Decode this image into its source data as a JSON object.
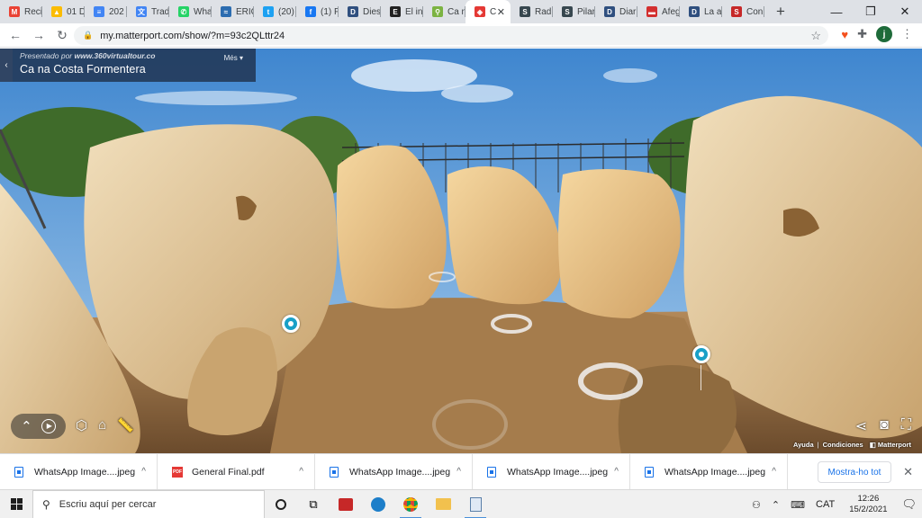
{
  "browser": {
    "tabs": [
      {
        "label": "Reci",
        "icon": "gmail-icon",
        "color": "#ea4335",
        "glyph": "M"
      },
      {
        "label": "01 D",
        "icon": "drive-icon",
        "color": "#fbbc04",
        "glyph": "▲"
      },
      {
        "label": "202",
        "icon": "docs-icon",
        "color": "#4285f4",
        "glyph": "≡"
      },
      {
        "label": "Trad",
        "icon": "translate-icon",
        "color": "#4285f4",
        "glyph": "文"
      },
      {
        "label": "Wha",
        "icon": "whatsapp-icon",
        "color": "#25d366",
        "glyph": "✆"
      },
      {
        "label": "ERIC",
        "icon": "eric-icon",
        "color": "#2b6cb0",
        "glyph": "≈"
      },
      {
        "label": "(20)",
        "icon": "twitter-icon",
        "color": "#1da1f2",
        "glyph": "t"
      },
      {
        "label": "(1) F",
        "icon": "facebook-icon",
        "color": "#1877f2",
        "glyph": "f"
      },
      {
        "label": "Dies",
        "icon": "newspaper-icon",
        "color": "#2f4f7f",
        "glyph": "D"
      },
      {
        "label": "El in",
        "icon": "newspaper-e-icon",
        "color": "#222222",
        "glyph": "E"
      },
      {
        "label": "Ca n",
        "icon": "pin-icon",
        "color": "#7cb342",
        "glyph": "⚲"
      },
      {
        "label": "C",
        "icon": "matterport-icon",
        "color": "#e53935",
        "glyph": "◈",
        "active": true
      },
      {
        "label": "Rad",
        "icon": "site-s-icon",
        "color": "#37474f",
        "glyph": "S"
      },
      {
        "label": "Pilar",
        "icon": "site-s-icon",
        "color": "#37474f",
        "glyph": "S"
      },
      {
        "label": "Diar",
        "icon": "newspaper-icon",
        "color": "#2f4f7f",
        "glyph": "D"
      },
      {
        "label": "Afeg",
        "icon": "flag-icon",
        "color": "#d32f2f",
        "glyph": "▬"
      },
      {
        "label": "La a",
        "icon": "newspaper-icon",
        "color": "#2f4f7f",
        "glyph": "D"
      },
      {
        "label": "Con",
        "icon": "circle-s-icon",
        "color": "#c62828",
        "glyph": "S"
      }
    ],
    "url": "my.matterport.com/show/?m=93c2QLttr24",
    "avatar_letter": "j"
  },
  "viewer": {
    "presented_prefix": "Presentado por",
    "presented_site": "www.360virtualtour.co",
    "more_label": "Més",
    "title": "Ca na Costa Formentera",
    "links": {
      "help": "Ayuda",
      "conditions": "Condiciones",
      "brand": "Matterport"
    }
  },
  "downloads": {
    "items": [
      {
        "name": "WhatsApp Image....jpeg",
        "type": "image"
      },
      {
        "name": "General Final.pdf",
        "type": "pdf"
      },
      {
        "name": "WhatsApp Image....jpeg",
        "type": "image"
      },
      {
        "name": "WhatsApp Image....jpeg",
        "type": "image"
      },
      {
        "name": "WhatsApp Image....jpeg",
        "type": "image"
      }
    ],
    "show_all": "Mostra-ho tot"
  },
  "taskbar": {
    "search_placeholder": "Escriu aquí per cercar",
    "language": "CAT",
    "time": "12:26",
    "date": "15/2/2021"
  }
}
